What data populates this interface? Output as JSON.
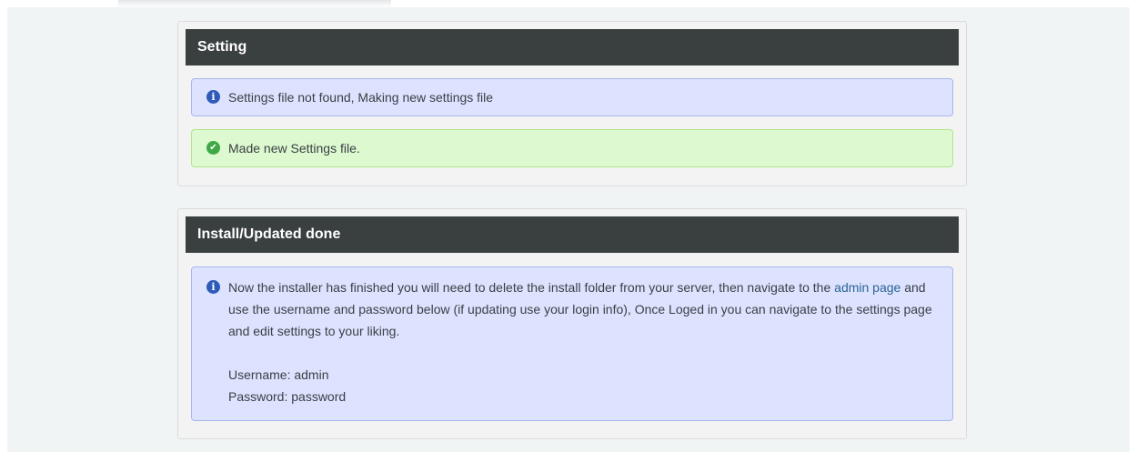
{
  "settings_panel": {
    "title": "Setting",
    "info_message": "Settings file not found, Making new settings file",
    "success_message": "Made new Settings file."
  },
  "done_panel": {
    "title": "Install/Updated done",
    "message_before_link": "Now the installer has finished you will need to delete the install folder from your server, then navigate to the ",
    "link_text": "admin page",
    "message_after_link": " and use the username and password below (if updating use your login info), Once Loged in you can navigate to the settings page and edit settings to your liking.",
    "username_line": "Username: admin",
    "password_line": "Password: password"
  },
  "icons": {
    "info": "info-circle-icon",
    "success": "check-circle-icon"
  },
  "colors": {
    "header_bg": "#3a3f3f",
    "info_bg": "#dde3ff",
    "success_bg": "#ddf9cf",
    "link": "#2a6496"
  }
}
